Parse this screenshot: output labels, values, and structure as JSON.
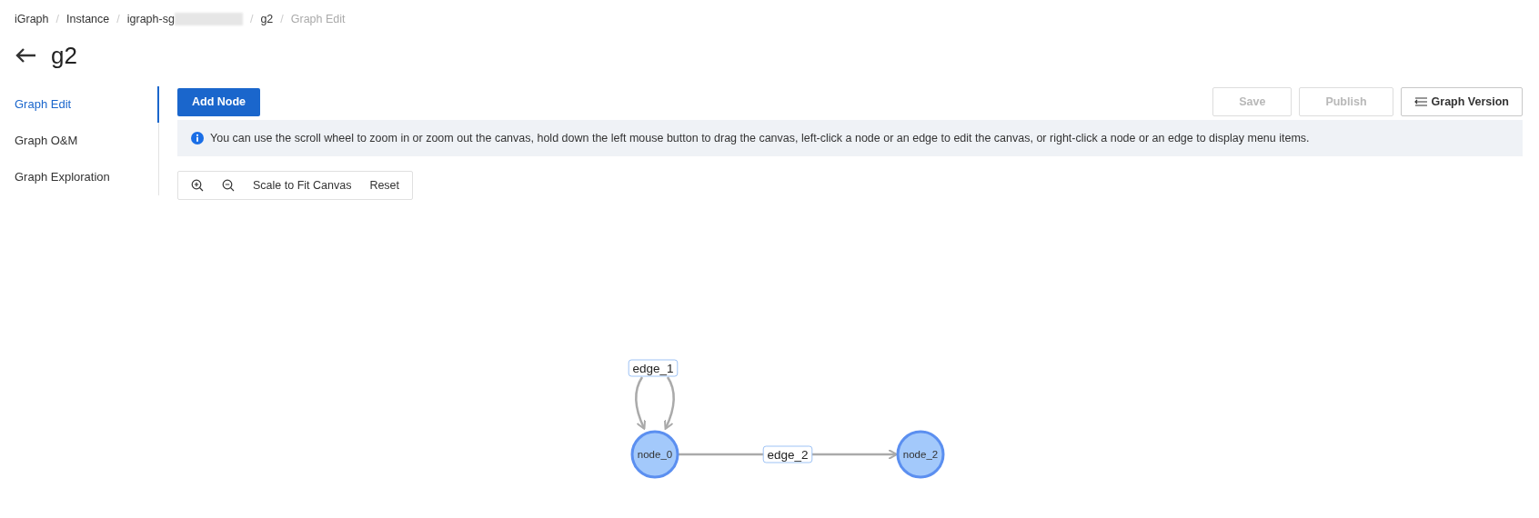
{
  "breadcrumb": [
    {
      "label": "iGraph",
      "selected": false,
      "redacted": false
    },
    {
      "separator": "/",
      "label": "Instance",
      "selected": false,
      "redacted": false
    },
    {
      "separator": "/",
      "label": "igraph-sg",
      "selected": false,
      "redacted": true
    },
    {
      "separator": "/",
      "label": "g2",
      "selected": false,
      "redacted": false
    },
    {
      "separator": "/",
      "label": "Graph Edit",
      "selected": true,
      "redacted": false
    }
  ],
  "page_title": "g2",
  "sidebar": {
    "items": [
      {
        "label": "Graph Edit",
        "selected": true
      },
      {
        "label": "Graph O&M",
        "selected": false
      },
      {
        "label": "Graph Exploration",
        "selected": false
      }
    ]
  },
  "toolbar": {
    "add_button": "Add Node",
    "buttons": [
      {
        "label": "Save",
        "disabled": true,
        "kind": "plain"
      },
      {
        "label": "Publish",
        "disabled": true,
        "kind": "plain"
      },
      {
        "label": "Graph Version",
        "disabled": false,
        "kind": "menu"
      }
    ]
  },
  "info": "You can use the scroll wheel to zoom in or zoom out the canvas, hold down the left mouse button to drag the canvas, left-click a node or an edge to edit the canvas, or right-click a node or an edge to display menu items.",
  "canvas_tools": [
    {
      "kind": "zoom_in"
    },
    {
      "kind": "zoom_out"
    },
    {
      "kind": "text",
      "label": "Scale to Fit Canvas"
    },
    {
      "kind": "text",
      "label": "Reset"
    }
  ],
  "graph": {
    "nodes": [
      {
        "label": "node_0"
      },
      {
        "label": "node_2"
      }
    ],
    "edges": [
      {
        "label": "edge_1",
        "kind": "loop"
      },
      {
        "label": "edge_2",
        "kind": "straight"
      }
    ]
  }
}
